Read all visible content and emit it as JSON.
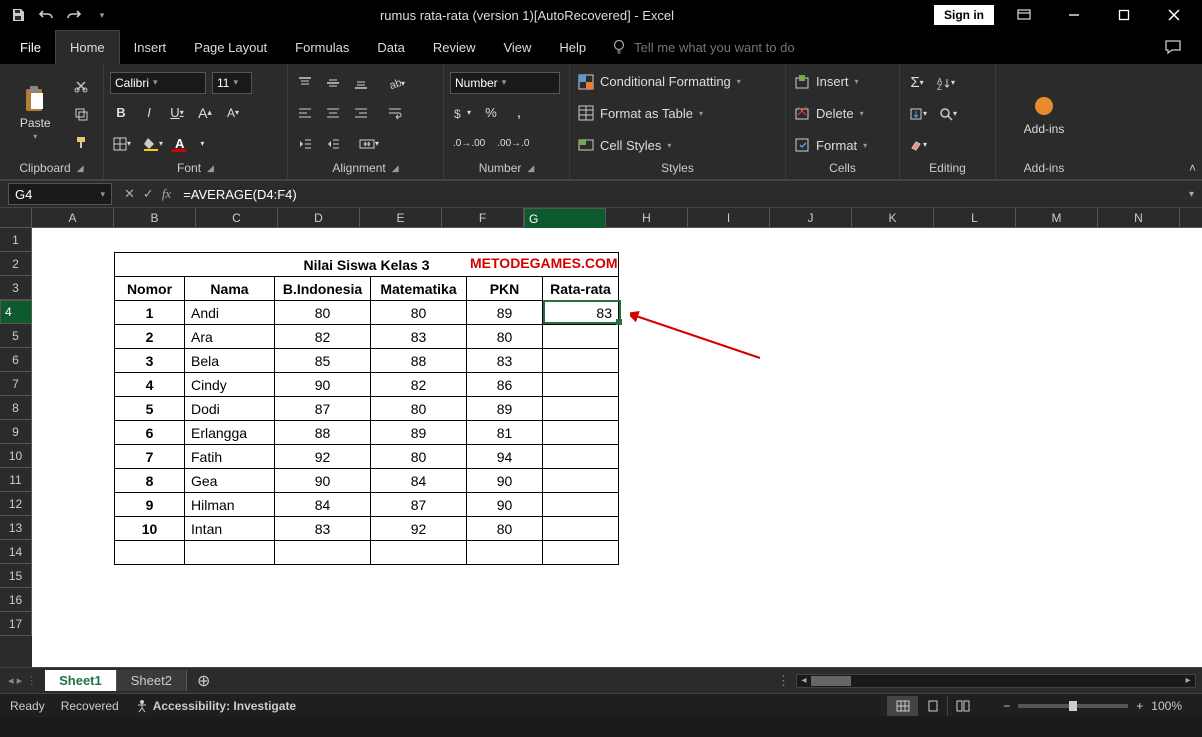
{
  "title": "rumus rata-rata (version 1)[AutoRecovered]  -  Excel",
  "signin": "Sign in",
  "tabs": [
    "File",
    "Home",
    "Insert",
    "Page Layout",
    "Formulas",
    "Data",
    "Review",
    "View",
    "Help"
  ],
  "active_tab": "Home",
  "tellme_placeholder": "Tell me what you want to do",
  "ribbon": {
    "clipboard": {
      "label": "Clipboard",
      "paste": "Paste"
    },
    "font": {
      "label": "Font",
      "name": "Calibri",
      "size": "11"
    },
    "alignment": {
      "label": "Alignment"
    },
    "number": {
      "label": "Number",
      "format": "Number"
    },
    "styles": {
      "label": "Styles",
      "cond": "Conditional Formatting",
      "table": "Format as Table",
      "cell": "Cell Styles"
    },
    "cells": {
      "label": "Cells",
      "insert": "Insert",
      "delete": "Delete",
      "format": "Format"
    },
    "editing": {
      "label": "Editing"
    },
    "addins": {
      "label": "Add-ins",
      "btn": "Add-ins"
    }
  },
  "namebox": "G4",
  "formula": "=AVERAGE(D4:F4)",
  "columns": [
    "A",
    "B",
    "C",
    "D",
    "E",
    "F",
    "G",
    "H",
    "I",
    "J",
    "K",
    "L",
    "M",
    "N"
  ],
  "rows_count": 17,
  "selected_cell": {
    "col": "G",
    "row": 4
  },
  "table": {
    "title": "Nilai Siswa Kelas 3",
    "watermark": "METODEGAMES.COM",
    "headers": [
      "Nomor",
      "Nama",
      "B.Indonesia",
      "Matematika",
      "PKN",
      "Rata-rata"
    ],
    "rows": [
      {
        "no": "1",
        "nama": "Andi",
        "bi": "80",
        "mat": "80",
        "pkn": "89",
        "rata": "83"
      },
      {
        "no": "2",
        "nama": "Ara",
        "bi": "82",
        "mat": "83",
        "pkn": "80",
        "rata": ""
      },
      {
        "no": "3",
        "nama": "Bela",
        "bi": "85",
        "mat": "88",
        "pkn": "83",
        "rata": ""
      },
      {
        "no": "4",
        "nama": "Cindy",
        "bi": "90",
        "mat": "82",
        "pkn": "86",
        "rata": ""
      },
      {
        "no": "5",
        "nama": "Dodi",
        "bi": "87",
        "mat": "80",
        "pkn": "89",
        "rata": ""
      },
      {
        "no": "6",
        "nama": "Erlangga",
        "bi": "88",
        "mat": "89",
        "pkn": "81",
        "rata": ""
      },
      {
        "no": "7",
        "nama": "Fatih",
        "bi": "92",
        "mat": "80",
        "pkn": "94",
        "rata": ""
      },
      {
        "no": "8",
        "nama": "Gea",
        "bi": "90",
        "mat": "84",
        "pkn": "90",
        "rata": ""
      },
      {
        "no": "9",
        "nama": "Hilman",
        "bi": "84",
        "mat": "87",
        "pkn": "90",
        "rata": ""
      },
      {
        "no": "10",
        "nama": "Intan",
        "bi": "83",
        "mat": "92",
        "pkn": "80",
        "rata": ""
      }
    ]
  },
  "sheet_tabs": [
    "Sheet1",
    "Sheet2"
  ],
  "active_sheet": "Sheet1",
  "status": {
    "ready": "Ready",
    "recovered": "Recovered",
    "access": "Accessibility: Investigate",
    "zoom": "100%"
  }
}
